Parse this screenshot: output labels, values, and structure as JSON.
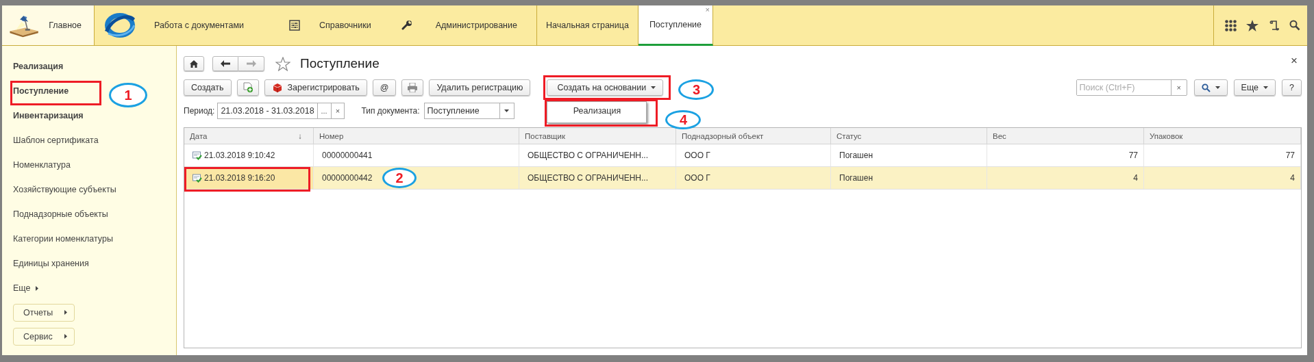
{
  "topbar": {
    "sections": [
      {
        "kind": "home",
        "label": "Главное"
      },
      {
        "kind": "logo",
        "label": "Работа с документами"
      },
      {
        "kind": "sliders",
        "label": "Справочники"
      },
      {
        "kind": "wrench",
        "label": "Администрирование"
      }
    ],
    "tabs": [
      {
        "label": "Начальная страница",
        "selected": false
      },
      {
        "label": "Поступление",
        "selected": true,
        "close": "×"
      }
    ]
  },
  "sidebar": {
    "items": [
      {
        "kind": "section",
        "label": "Реализация"
      },
      {
        "kind": "section",
        "label": "Поступление",
        "annotation": "1"
      },
      {
        "kind": "section",
        "label": "Инвентаризация"
      },
      {
        "kind": "link",
        "label": "Шаблон сертификата"
      },
      {
        "kind": "link",
        "label": "Номенклатура"
      },
      {
        "kind": "link",
        "label": "Хозяйствующие субъекты"
      },
      {
        "kind": "link",
        "label": "Поднадзорные объекты"
      },
      {
        "kind": "link",
        "label": "Категории номенклатуры"
      },
      {
        "kind": "link",
        "label": "Единицы хранения"
      },
      {
        "kind": "more",
        "label": "Еще"
      },
      {
        "kind": "group",
        "label": "Отчеты"
      },
      {
        "kind": "group",
        "label": "Сервис"
      }
    ]
  },
  "form": {
    "title": "Поступление",
    "close": "×",
    "toolbar": [
      {
        "kind": "button",
        "label": "Создать"
      },
      {
        "kind": "add-icon"
      },
      {
        "kind": "register",
        "label": "Зарегистрировать"
      },
      {
        "kind": "button",
        "label": "@"
      },
      {
        "kind": "print-icon"
      },
      {
        "kind": "button",
        "label": "Удалить регистрацию"
      },
      {
        "kind": "dropdown",
        "label": "Создать на основании",
        "annotation": "3",
        "menu": {
          "items": [
            "Реализация"
          ],
          "annotation": "4"
        }
      }
    ],
    "search": {
      "placeholder": "Поиск (Ctrl+F)",
      "clear": "×"
    },
    "right_buttons": [
      {
        "kind": "search-dropdown"
      },
      {
        "kind": "dropdown",
        "label": "Еще"
      },
      {
        "kind": "button",
        "label": "?"
      }
    ],
    "filters": {
      "period_label": "Период:",
      "period": "21.03.2018 - 31.03.2018",
      "pick": "...",
      "clear": "×",
      "type_label": "Тип документа:",
      "type": "Поступление"
    },
    "table": {
      "columns": [
        {
          "label": "Дата",
          "sort_mark": "↓",
          "kind": "text"
        },
        {
          "label": "Номер",
          "kind": "text"
        },
        {
          "label": "Поставщик",
          "kind": "text"
        },
        {
          "label": "Поднадзорный объект",
          "kind": "text"
        },
        {
          "label": "Статус",
          "kind": "text"
        },
        {
          "label": "Вес",
          "kind": "number"
        },
        {
          "label": "Упаковок",
          "kind": "number"
        }
      ],
      "rows": [
        {
          "selected": false,
          "cells": [
            "21.03.2018 9:10:42",
            "00000000441",
            "ОБЩЕСТВО С ОГРАНИЧЕНН...",
            "ООО Г",
            "Погашен",
            "77",
            "77"
          ]
        },
        {
          "selected": true,
          "annotation": "2",
          "cells": [
            "21.03.2018 9:16:20",
            "00000000442",
            "ОБЩЕСТВО С ОГРАНИЧЕНН...",
            "ООО Г",
            "Погашен",
            "4",
            "4"
          ]
        }
      ]
    }
  }
}
